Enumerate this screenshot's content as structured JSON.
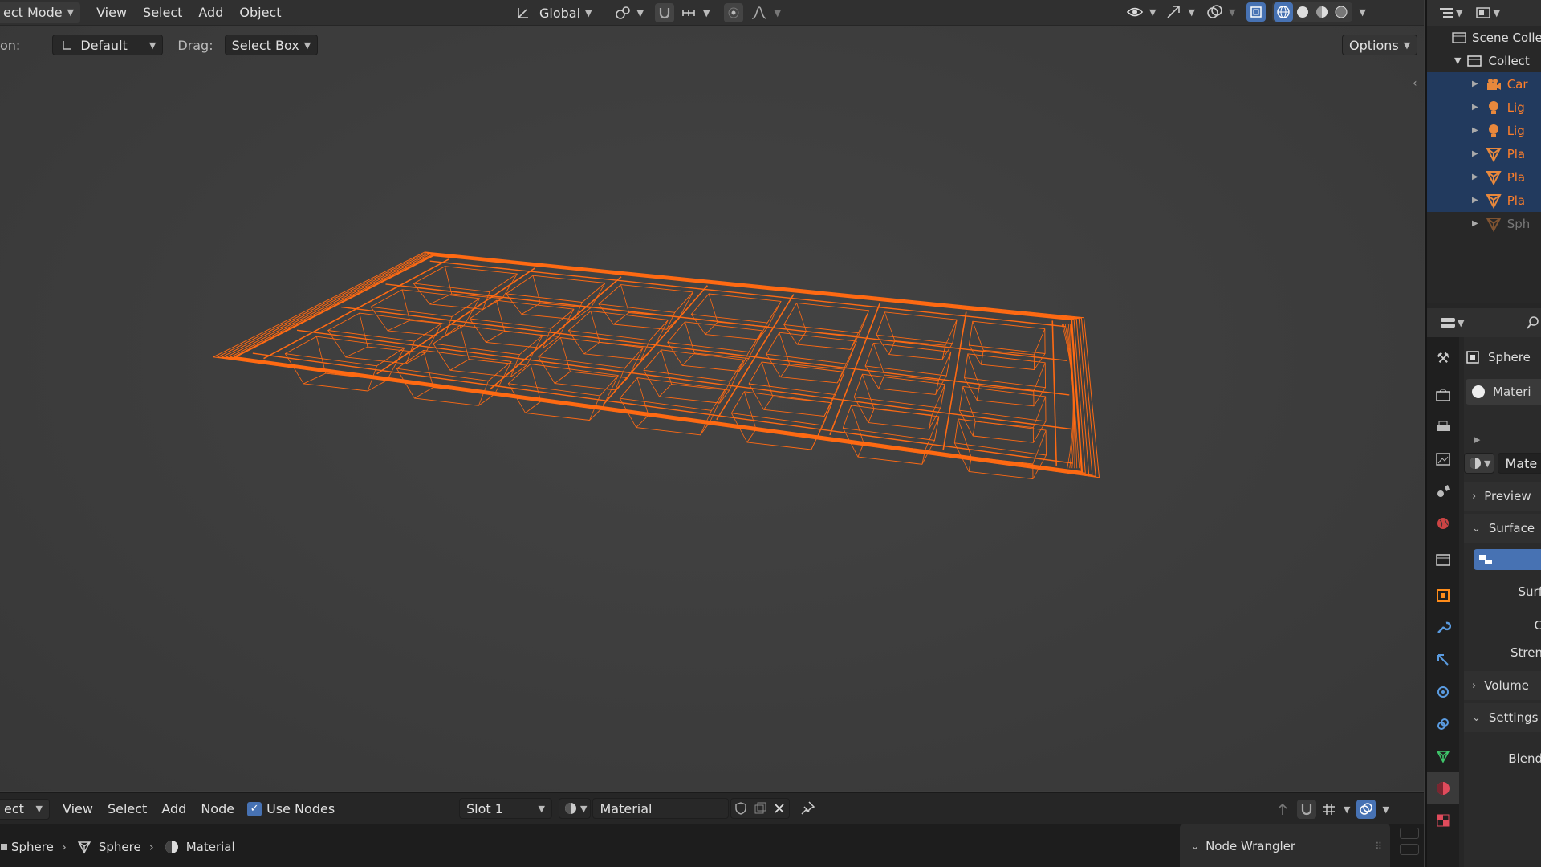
{
  "header": {
    "mode_label": "ect Mode",
    "menus": [
      "View",
      "Select",
      "Add",
      "Object"
    ],
    "transform_orientation": "Global"
  },
  "toolbar": {
    "orientation_label": "on:",
    "orientation_value": "Default",
    "drag_label": "Drag:",
    "drag_value": "Select Box",
    "options_label": "Options"
  },
  "outliner": {
    "scene_collection": "Scene Colle",
    "collection": "Collect",
    "items": [
      {
        "label": "Car",
        "icon": "camera-icon",
        "selected": true
      },
      {
        "label": "Lig",
        "icon": "light-icon",
        "selected": true
      },
      {
        "label": "Lig",
        "icon": "light-icon",
        "selected": true
      },
      {
        "label": "Pla",
        "icon": "mesh-icon",
        "selected": true
      },
      {
        "label": "Pla",
        "icon": "mesh-icon",
        "selected": true
      },
      {
        "label": "Pla",
        "icon": "mesh-icon",
        "selected": true
      },
      {
        "label": "Sph",
        "icon": "mesh-icon",
        "selected": false
      }
    ]
  },
  "properties": {
    "object_name": "Sphere",
    "material_slot": "Materi",
    "material_name": "Mate",
    "sections": {
      "preview": "Preview",
      "surface": "Surface",
      "surf_field": "Surf",
      "color_field": "C",
      "strength_field": "Stren",
      "volume": "Volume",
      "settings": "Settings",
      "blend": "Blend"
    }
  },
  "node_editor": {
    "mode_label": "ect",
    "menus": [
      "View",
      "Select",
      "Add",
      "Node"
    ],
    "use_nodes_label": "Use Nodes",
    "use_nodes_checked": true,
    "slot_value": "Slot 1",
    "material_value": "Material"
  },
  "breadcrumb": [
    "Sphere",
    "Sphere",
    "Material"
  ],
  "node_wrangler_label": "Node Wrangler",
  "colors": {
    "wire": "#ff6a13",
    "selection": "#223a5e",
    "accent": "#4772b3"
  }
}
